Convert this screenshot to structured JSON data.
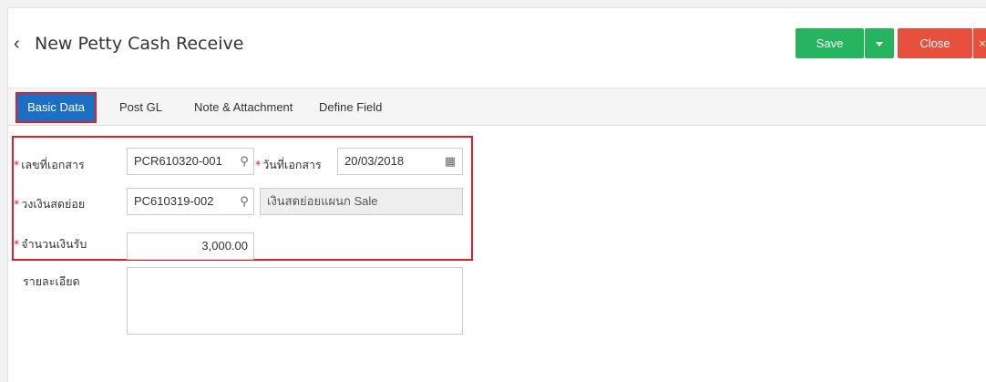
{
  "header": {
    "title": "New Petty Cash Receive",
    "back_icon": "chevron-left-icon",
    "save_label": "Save",
    "close_label": "Close",
    "close_x": "×"
  },
  "colors": {
    "save": "#26b45e",
    "close": "#e8503e",
    "tab_active": "#1c6fc2",
    "highlight": "#e0202a",
    "required": "#e0202a"
  },
  "tabs": [
    {
      "label": "Basic Data",
      "active": true
    },
    {
      "label": "Post GL",
      "active": false
    },
    {
      "label": "Note & Attachment",
      "active": false
    },
    {
      "label": "Define Field",
      "active": false
    }
  ],
  "form": {
    "required_mark": "*",
    "doc_no_label": "เลขที่เอกสาร",
    "doc_no_value": "PCR610320-001",
    "doc_date_label": "วันที่เอกสาร",
    "doc_date_value": "20/03/2018",
    "fund_label": "วงเงินสดย่อย",
    "fund_code": "PC610319-002",
    "fund_name": "เงินสดย่อยแผนก Sale",
    "amount_label": "จำนวนเงินรับ",
    "amount_value": "3,000.00",
    "detail_label": "รายละเอียด",
    "detail_value": ""
  }
}
